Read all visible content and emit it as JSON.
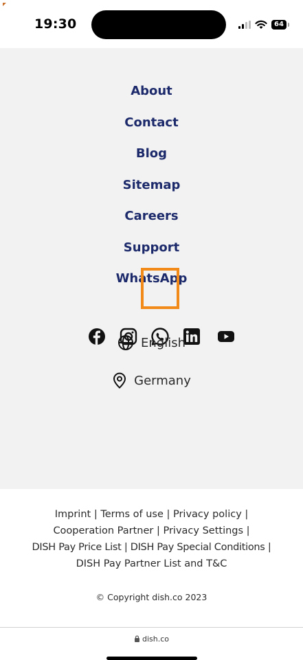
{
  "status_bar": {
    "time": "19:30",
    "battery": "64",
    "icons": [
      "signal-icon",
      "wifi-icon",
      "battery-icon"
    ]
  },
  "footer": {
    "links": [
      "About",
      "Contact",
      "Blog",
      "Sitemap",
      "Careers",
      "Support",
      "WhatsApp"
    ],
    "social": [
      {
        "name": "facebook-icon"
      },
      {
        "name": "instagram-icon"
      },
      {
        "name": "whatsapp-icon",
        "highlighted": true
      },
      {
        "name": "linkedin-icon"
      },
      {
        "name": "youtube-icon"
      }
    ],
    "language": "English",
    "country": "Germany"
  },
  "legal": {
    "imprint": "Imprint",
    "terms": "Terms of use",
    "privacy_policy": "Privacy policy",
    "cooperation": "Cooperation Partner",
    "privacy_settings": "Privacy Settings",
    "pay_price_list": "DISH Pay Price List",
    "pay_special": "DISH Pay Special Conditions",
    "pay_partner": "DISH Pay Partner List and T&C",
    "separator": "|",
    "copyright": "© Copyright dish.co 2023"
  },
  "url_bar": {
    "domain": "dish.co"
  },
  "colors": {
    "link": "#1c2a6b",
    "footer_bg": "#f2f2f2",
    "highlight": "#f28a1a"
  }
}
